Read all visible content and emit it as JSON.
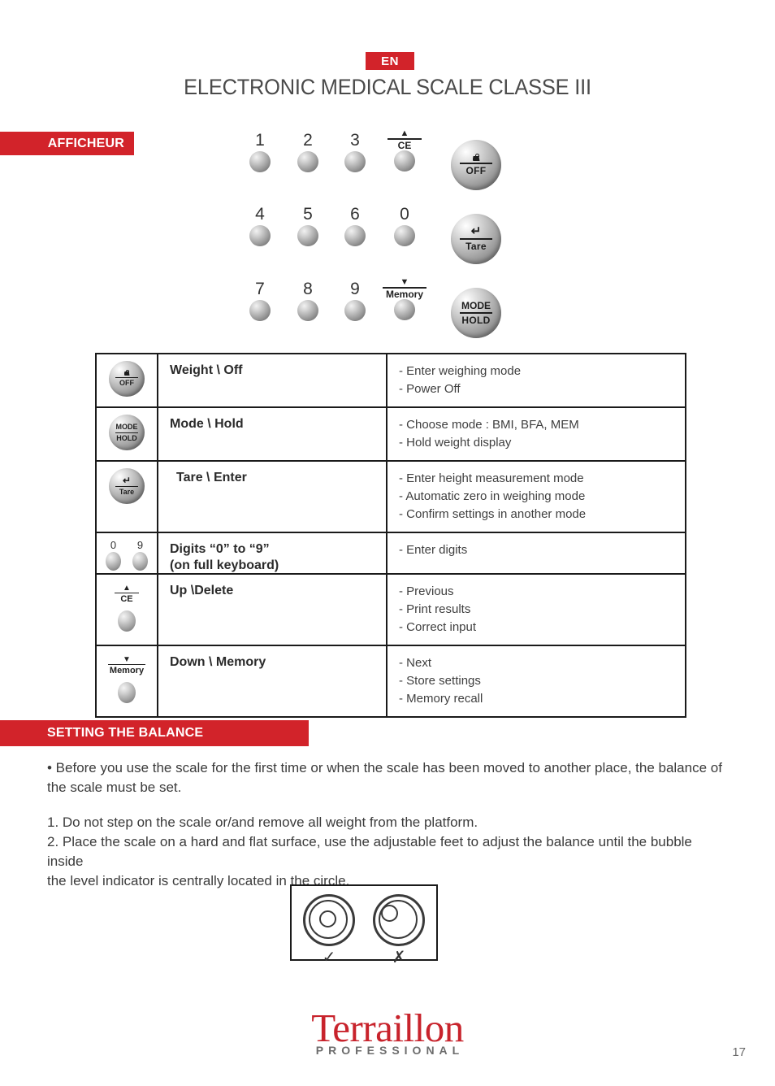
{
  "header": {
    "language_badge": "EN",
    "title": "ELECTRONIC MEDICAL SCALE CLASSE III"
  },
  "sections": {
    "display_banner": "AFFICHEUR",
    "setting_banner": "SETTING THE BALANCE"
  },
  "keypad": {
    "rows": [
      {
        "keys": [
          "1",
          "2",
          "3"
        ],
        "special": {
          "arrow": "▲",
          "label": "CE"
        }
      },
      {
        "keys": [
          "4",
          "5",
          "6",
          "0"
        ],
        "special": null
      },
      {
        "keys": [
          "7",
          "8",
          "9"
        ],
        "special": {
          "arrow": "▼",
          "label": "Memory"
        }
      }
    ],
    "function_keys": [
      {
        "name": "weight-off-key",
        "icon": "weight-icon",
        "label": "OFF"
      },
      {
        "name": "tare-key",
        "icon": "enter-arrow-icon",
        "arrow": "↵",
        "label": "Tare"
      },
      {
        "name": "mode-hold-key",
        "top": "MODE",
        "label": "HOLD"
      }
    ]
  },
  "key_table": {
    "rows": [
      {
        "icon": "weight-off-key-icon",
        "name": "Weight \\ Off",
        "descriptions": [
          "- Enter weighing mode",
          "- Power Off"
        ]
      },
      {
        "icon": "mode-hold-key-icon",
        "name": "Mode \\ Hold",
        "descriptions": [
          "- Choose mode : BMI, BFA, MEM",
          "- Hold weight display"
        ]
      },
      {
        "icon": "tare-enter-key-icon",
        "name": "Tare \\  Enter",
        "descriptions": [
          "- Enter height measurement mode",
          "- Automatic zero in weighing mode",
          "- Confirm settings in another mode"
        ]
      },
      {
        "icon": "digit-keys-icon",
        "digit_low": "0",
        "digit_high": "9",
        "name": "Digits “0” to “9”",
        "name_line2": "(on full keyboard)",
        "descriptions": [
          "- Enter digits"
        ]
      },
      {
        "icon": "up-delete-key-icon",
        "arrow": "▲",
        "arrow_label": "CE",
        "name": "Up \\Delete",
        "descriptions": [
          "- Previous",
          "- Print results",
          "- Correct input"
        ]
      },
      {
        "icon": "down-memory-key-icon",
        "arrow": "▼",
        "arrow_label": "Memory",
        "name": "Down \\ Memory",
        "descriptions": [
          "- Next",
          "- Store settings",
          "- Memory recall"
        ]
      }
    ]
  },
  "balance_text": {
    "intro_line1": "• Before you use the scale for the first time or when the scale has been moved to another place, the balance of",
    "intro_line2": "the scale must be set.",
    "step1": "1. Do not step on the scale or/and remove all weight from the platform.",
    "step2_line1": "2. Place the scale on a hard and flat surface, use the adjustable feet to adjust the balance until the bubble inside",
    "step2_line2": "the level indicator is centrally located in the circle."
  },
  "level_figure": {
    "correct_mark": "✓",
    "incorrect_mark": "✗"
  },
  "footer": {
    "logo_name": "Terraillon",
    "logo_subtitle": "PROFESSIONAL",
    "page_number": "17"
  },
  "colors": {
    "brand_red": "#d2232a",
    "logo_red": "#c8232c",
    "text_gray": "#3b3b3b"
  }
}
